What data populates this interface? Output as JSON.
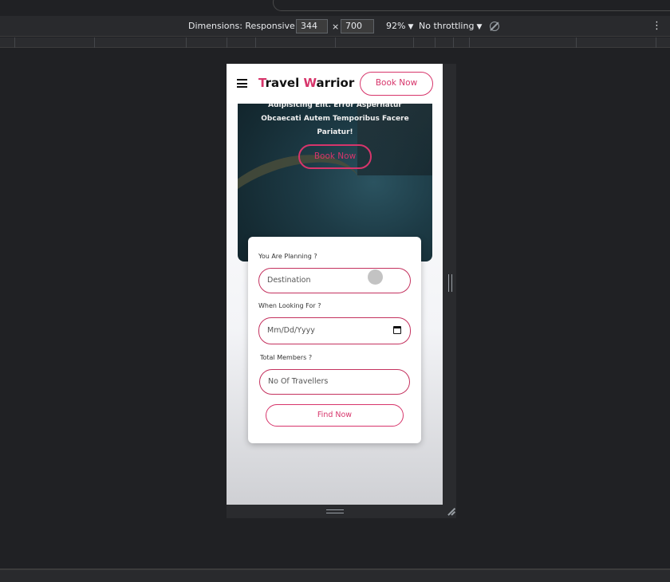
{
  "devtools": {
    "dimensions_label": "Dimensions: Responsive",
    "width": "344",
    "times": "×",
    "height": "700",
    "zoom": "92%",
    "throttling": "No throttling",
    "menu_glyph": "⋮",
    "caret": "▼"
  },
  "site": {
    "brand_first_letter": "T",
    "brand_middle": "ravel ",
    "brand_second_letter": "W",
    "brand_rest": "arrior",
    "accent_color": "#d7356b",
    "nav_button_label": "Book Now",
    "hero": {
      "line1": "Adipisicing Elit. Error Aspernatur",
      "line2": "Obcaecati Autem Temporibus Facere",
      "line3": "Pariatur!",
      "button_label": "Book Now"
    },
    "form": {
      "planning_label": "You Are Planning ?",
      "destination_placeholder": "Destination",
      "when_label": "When Looking For ?",
      "date_placeholder": "Mm/Dd/Yyyy",
      "members_label": "Total Members ?",
      "travellers_placeholder": "No Of Travellers",
      "submit_label": "Find Now"
    }
  }
}
